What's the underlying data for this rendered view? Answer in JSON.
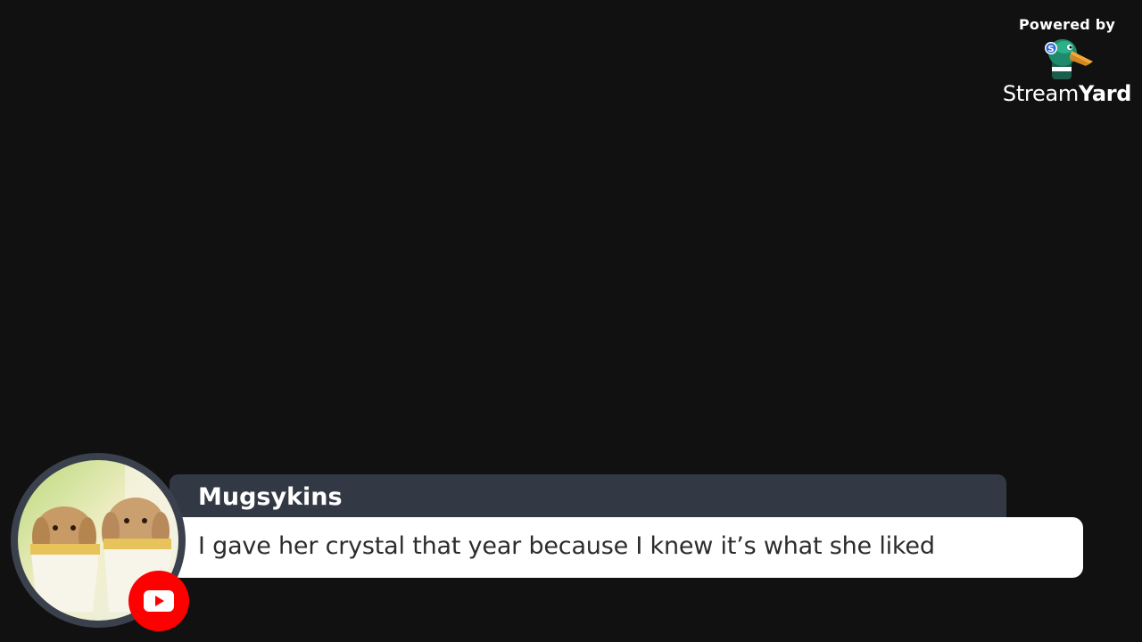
{
  "branding": {
    "powered_by": "Powered by",
    "brand_name_part1": "Stream",
    "brand_name_part2": "Yard",
    "logo_icon": "streamyard-duck-logo-icon"
  },
  "comment": {
    "author": "Mugsykins",
    "message": "I gave her crystal that year because I knew it’s what she liked",
    "avatar_icon": "avatar-bunnies-image",
    "platform_icon": "youtube-icon"
  },
  "colors": {
    "background": "#111112",
    "name_bar": "#323945",
    "message_bar": "#ffffff",
    "youtube_red": "#ff0000"
  }
}
